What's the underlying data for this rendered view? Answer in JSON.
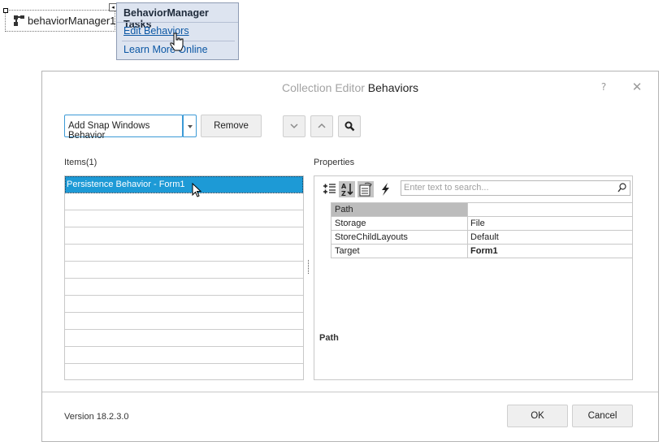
{
  "designer": {
    "component_label": "behaviorManager1",
    "component_icon": "behavior-manager-icon",
    "smart_tag": {
      "title": "BehaviorManager Tasks",
      "links": [
        "Edit Behaviors",
        "Learn More Online"
      ]
    }
  },
  "dialog": {
    "title_prefix": "Collection Editor ",
    "title_main": "Behaviors",
    "help_label": "?",
    "close_label": "✕",
    "toolbar": {
      "add_label": "Add Snap Windows Behavior",
      "remove_label": "Remove",
      "icons": [
        "move-down-icon",
        "move-up-icon",
        "search-icon"
      ]
    },
    "items": {
      "label": "Items(1)",
      "rows": [
        "Persistence Behavior - Form1",
        "",
        "",
        "",
        "",
        "",
        "",
        "",
        "",
        "",
        "",
        ""
      ],
      "selected_index": 0
    },
    "properties": {
      "label": "Properties",
      "search_placeholder": "Enter text to search...",
      "toolbar_icons": [
        "categorized-icon",
        "alphabetical-icon",
        "property-pages-icon",
        "events-icon"
      ],
      "rows": [
        {
          "name": "Path",
          "value": "",
          "selected": true
        },
        {
          "name": "Storage",
          "value": "File"
        },
        {
          "name": "StoreChildLayouts",
          "value": "Default"
        },
        {
          "name": "Target",
          "value": "Form1",
          "bold": true
        }
      ],
      "description_title": "Path"
    },
    "footer": {
      "version": "Version 18.2.3.0",
      "ok_label": "OK",
      "cancel_label": "Cancel"
    }
  }
}
